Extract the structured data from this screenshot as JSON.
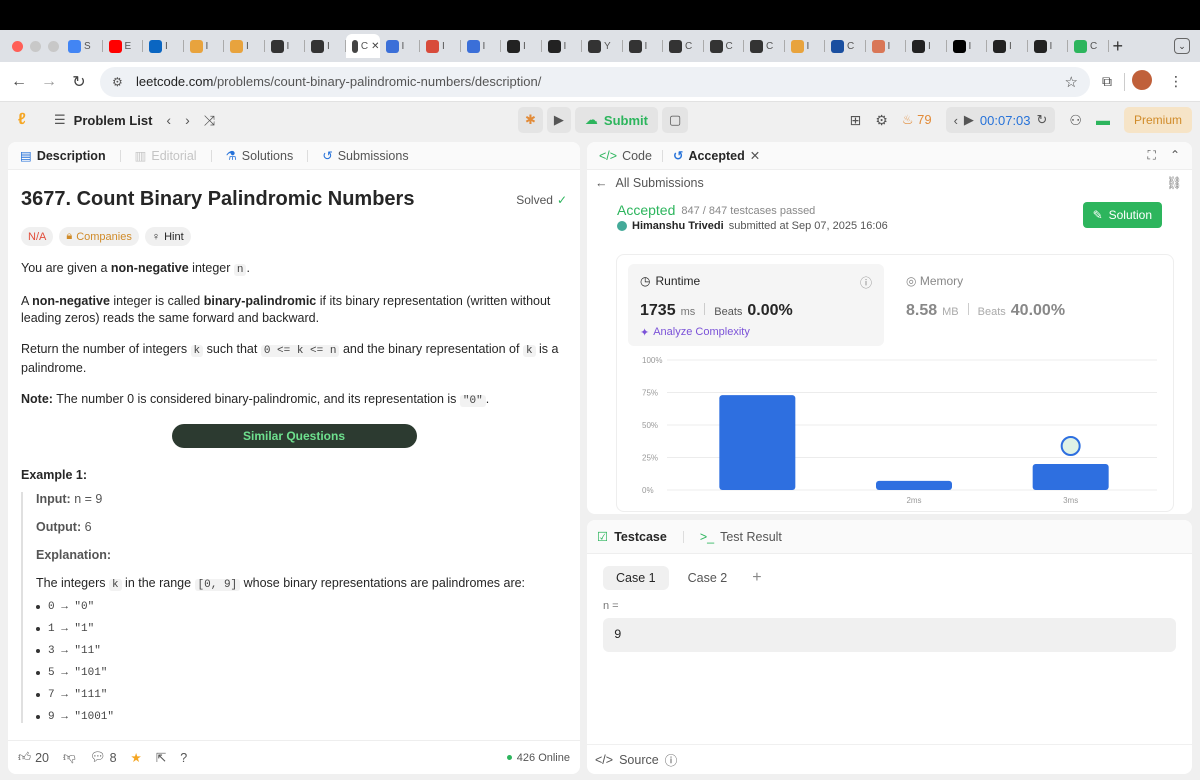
{
  "browser": {
    "tabs": [
      {
        "icon": "google-icon",
        "color": "#4285f4",
        "label": "S"
      },
      {
        "icon": "youtube-icon",
        "color": "#ff0000",
        "label": "E"
      },
      {
        "icon": "linkedin-icon",
        "color": "#0a66c2",
        "label": "I"
      },
      {
        "icon": "chart-icon",
        "color": "#e8a33d",
        "label": "I"
      },
      {
        "icon": "chart-icon",
        "color": "#e8a33d",
        "label": "I"
      },
      {
        "icon": "hourglass-icon",
        "color": "#333333",
        "label": "I"
      },
      {
        "icon": "hourglass-icon",
        "color": "#333333",
        "label": "I"
      },
      {
        "icon": "active-tab-icon",
        "color": "#444444",
        "label": "C",
        "active": true
      },
      {
        "icon": "chart-icon",
        "color": "#3b6fd8",
        "label": "I"
      },
      {
        "icon": "chart-icon",
        "color": "#d84b3b",
        "label": "I"
      },
      {
        "icon": "chart-icon",
        "color": "#3b6fd8",
        "label": "I"
      },
      {
        "icon": "openai-icon",
        "color": "#222222",
        "label": "I"
      },
      {
        "icon": "openai-icon",
        "color": "#222222",
        "label": "I"
      },
      {
        "icon": "hourglass-icon",
        "color": "#333333",
        "label": "Y"
      },
      {
        "icon": "hourglass-icon",
        "color": "#333333",
        "label": "I"
      },
      {
        "icon": "hourglass-icon",
        "color": "#333333",
        "label": "C"
      },
      {
        "icon": "hourglass-icon",
        "color": "#333333",
        "label": "C"
      },
      {
        "icon": "hourglass-icon",
        "color": "#333333",
        "label": "C"
      },
      {
        "icon": "chart-icon",
        "color": "#e8a33d",
        "label": "I"
      },
      {
        "icon": "grid-icon",
        "color": "#1a4fa0",
        "label": "C"
      },
      {
        "icon": "claude-icon",
        "color": "#d97757",
        "label": "I"
      },
      {
        "icon": "github-icon",
        "color": "#222222",
        "label": "I"
      },
      {
        "icon": "x-icon",
        "color": "#000000",
        "label": "I"
      },
      {
        "icon": "openai-icon",
        "color": "#222222",
        "label": "I"
      },
      {
        "icon": "openai-icon",
        "color": "#222222",
        "label": "I"
      },
      {
        "icon": "plus-icon",
        "color": "#2db55d",
        "label": "C"
      }
    ],
    "new_tab": "+",
    "url_domain": "leetcode.com",
    "url_path": "/problems/count-binary-palindromic-numbers/description/"
  },
  "header": {
    "problem_list": "Problem List",
    "submit": "Submit",
    "streak": "79",
    "timer": "00:07:03",
    "premium": "Premium"
  },
  "left_tabs": {
    "description": "Description",
    "editorial": "Editorial",
    "solutions": "Solutions",
    "submissions": "Submissions"
  },
  "problem": {
    "title": "3677. Count Binary Palindromic Numbers",
    "solved": "Solved",
    "difficulty": "N/A",
    "companies": "Companies",
    "hint": "Hint",
    "p1_a": "You are given a ",
    "p1_b": "non-negative",
    "p1_c": " integer ",
    "p1_code": "n",
    "p1_d": ".",
    "p2_a": "A ",
    "p2_b": "non-negative",
    "p2_c": " integer is called ",
    "p2_d": "binary-palindromic",
    "p2_e": " if its binary representation (written without leading zeros) reads the same forward and backward.",
    "p3_a": "Return the number of integers ",
    "p3_code1": "k",
    "p3_b": " such that ",
    "p3_code2": "0 <= k <= n",
    "p3_c": " and the binary representation of ",
    "p3_code3": "k",
    "p3_d": " is a palindrome.",
    "p4_a": "Note:",
    "p4_b": " The number 0 is considered binary-palindromic, and its representation is ",
    "p4_code": "\"0\"",
    "p4_c": ".",
    "similar": "Similar Questions",
    "example_title": "Example 1:",
    "input_label": "Input:",
    "input_value": "n = 9",
    "output_label": "Output:",
    "output_value": "6",
    "explanation_label": "Explanation:",
    "exp_a": "The integers ",
    "exp_code1": "k",
    "exp_b": " in the range ",
    "exp_code2": "[0, 9]",
    "exp_c": " whose binary representations are palindromes are:",
    "list": [
      "0 → \"0\"",
      "1 → \"1\"",
      "3 → \"11\"",
      "5 → \"101\"",
      "7 → \"111\"",
      "9 → \"1001\""
    ]
  },
  "left_footer": {
    "likes": "20",
    "comments": "8",
    "online": "426 Online"
  },
  "right_tabs": {
    "code": "Code",
    "accepted": "Accepted"
  },
  "submission": {
    "all": "All Submissions",
    "status": "Accepted",
    "testcases": "847 / 847 testcases passed",
    "user": "Himanshu Trivedi",
    "submitted": "submitted at Sep 07, 2025 16:06",
    "solution_btn": "Solution",
    "runtime_label": "Runtime",
    "runtime_value": "1735",
    "runtime_unit": "ms",
    "beats": "Beats",
    "runtime_pct": "0.00%",
    "analyze": "Analyze Complexity",
    "memory_label": "Memory",
    "memory_value": "8.58",
    "memory_unit": "MB",
    "memory_pct": "40.00%"
  },
  "chart_data": {
    "type": "bar",
    "categories": [
      "",
      "2ms",
      "3ms"
    ],
    "values": [
      73,
      7,
      20
    ],
    "ylim": [
      0,
      100
    ],
    "yticks": [
      "0%",
      "25%",
      "50%",
      "75%",
      "100%"
    ],
    "bar_color": "#2e6fe0",
    "grid": true
  },
  "testcase": {
    "tab": "Testcase",
    "result_tab": "Test Result",
    "case1": "Case 1",
    "case2": "Case 2",
    "add": "+",
    "input_label": "n =",
    "input_value": "9",
    "source": "Source"
  }
}
